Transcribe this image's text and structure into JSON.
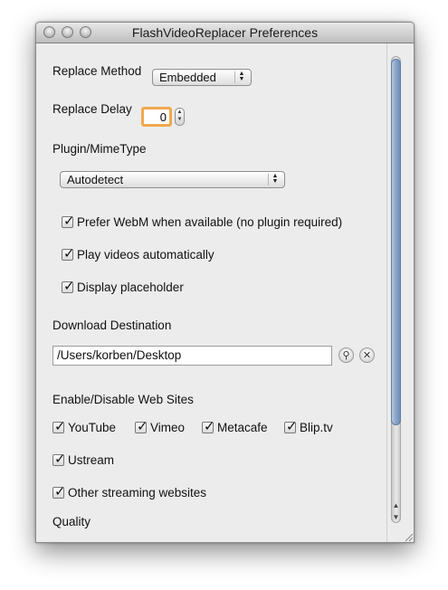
{
  "window": {
    "title": "FlashVideoReplacer Preferences"
  },
  "replace_method": {
    "label": "Replace Method",
    "value": "Embedded"
  },
  "replace_delay": {
    "label": "Replace Delay",
    "value": "0"
  },
  "plugin": {
    "label": "Plugin/MimeType",
    "value": "Autodetect"
  },
  "options": [
    {
      "label": "Prefer WebM when available (no plugin required)",
      "checked": true
    },
    {
      "label": "Play videos automatically",
      "checked": true
    },
    {
      "label": "Display placeholder",
      "checked": true
    }
  ],
  "download": {
    "label": "Download Destination",
    "path": "/Users/korben/Desktop"
  },
  "sites": {
    "label": "Enable/Disable Web Sites",
    "items": [
      {
        "label": "YouTube",
        "checked": true
      },
      {
        "label": "Vimeo",
        "checked": true
      },
      {
        "label": "Metacafe",
        "checked": true
      },
      {
        "label": "Blip.tv",
        "checked": true
      },
      {
        "label": "Ustream",
        "checked": true
      },
      {
        "label": "Other streaming websites",
        "checked": true
      }
    ]
  },
  "quality": {
    "label": "Quality"
  },
  "icons": {
    "search": "magnifier-icon",
    "clear": "close-x-icon"
  }
}
